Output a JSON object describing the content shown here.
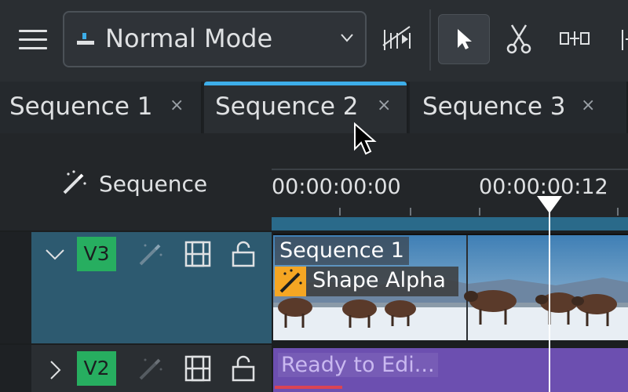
{
  "toolbar": {
    "mode_label": "Normal Mode",
    "icons": [
      "menu-icon",
      "mode-glyph-icon",
      "chevron-down-icon",
      "spacer-tool-icon",
      "select-tool-icon",
      "razor-tool-icon",
      "ripple-tool-icon",
      "slip-tool-icon"
    ]
  },
  "tabs": [
    {
      "label": "Sequence 1",
      "close": "×",
      "active": false
    },
    {
      "label": "Sequence 2",
      "close": "×",
      "active": true
    },
    {
      "label": "Sequence 3",
      "close": "×",
      "active": false
    }
  ],
  "timeline": {
    "header_label": "Sequence",
    "timecodes": [
      "00:00:00:00",
      "00:00:00:12"
    ]
  },
  "tracks": [
    {
      "name": "V3",
      "expanded": true,
      "clip_title": "Sequence 1",
      "effect": "Shape Alpha"
    },
    {
      "name": "V2",
      "expanded": false,
      "clip_title": "Ready to Edi..."
    }
  ],
  "colors": {
    "accent": "#3daee9",
    "track_badge": "#27ae60",
    "effect_badge": "#f5a623",
    "v2_clip": "#6c4fb0",
    "selected_track": "#2d5a70"
  }
}
